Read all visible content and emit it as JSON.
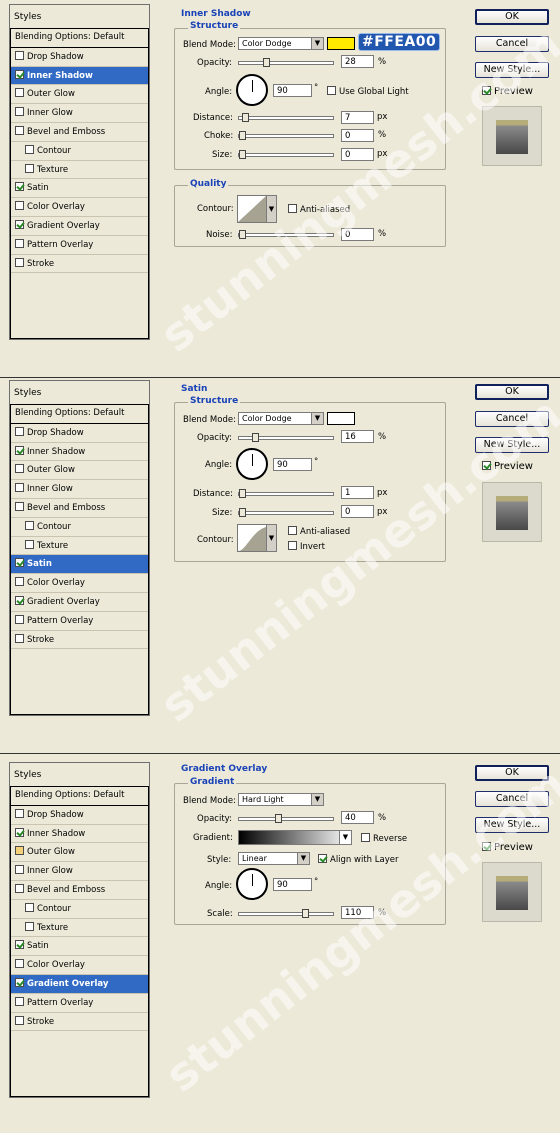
{
  "panels": [
    {
      "styles_title": "Styles",
      "items": [
        {
          "label": "Blending Options: Default",
          "check": false,
          "selected": false
        },
        {
          "label": "Drop Shadow",
          "check": false
        },
        {
          "label": "Inner Shadow",
          "check": true,
          "selected": true
        },
        {
          "label": "Outer Glow",
          "check": false
        },
        {
          "label": "Inner Glow",
          "check": false
        },
        {
          "label": "Bevel and Emboss",
          "check": false
        },
        {
          "label": "Contour",
          "check": false,
          "indent": true
        },
        {
          "label": "Texture",
          "check": false,
          "indent": true
        },
        {
          "label": "Satin",
          "check": true
        },
        {
          "label": "Color Overlay",
          "check": false
        },
        {
          "label": "Gradient Overlay",
          "check": true
        },
        {
          "label": "Pattern Overlay",
          "check": false
        },
        {
          "label": "Stroke",
          "check": false
        }
      ],
      "section_title": "Inner Shadow",
      "structure_title": "Structure",
      "blend_mode_label": "Blend Mode:",
      "blend_mode": "Color Dodge",
      "swatch_color": "#FFEA00",
      "opacity_label": "Opacity:",
      "opacity": "28",
      "angle_label": "Angle:",
      "angle": "90",
      "global_light_label": "Use Global Light",
      "distance_label": "Distance:",
      "distance": "7",
      "choke_label": "Choke:",
      "choke": "0",
      "size_label": "Size:",
      "size": "0",
      "quality_title": "Quality",
      "contour_label": "Contour:",
      "anti_aliased_label": "Anti-aliased",
      "noise_label": "Noise:",
      "noise": "0",
      "annotation": "#FFEA00"
    },
    {
      "styles_title": "Styles",
      "section_title": "Satin",
      "structure_title": "Structure",
      "blend_mode_label": "Blend Mode:",
      "blend_mode": "Color Dodge",
      "swatch_color": "#FFFFFF",
      "opacity_label": "Opacity:",
      "opacity": "16",
      "angle_label": "Angle:",
      "angle": "90",
      "distance_label": "Distance:",
      "distance": "1",
      "size_label": "Size:",
      "size": "0",
      "contour_label": "Contour:",
      "anti_aliased_label": "Anti-aliased",
      "invert_label": "Invert",
      "items": [
        {
          "label": "Blending Options: Default",
          "check": false
        },
        {
          "label": "Drop Shadow",
          "check": false
        },
        {
          "label": "Inner Shadow",
          "check": true
        },
        {
          "label": "Outer Glow",
          "check": false
        },
        {
          "label": "Inner Glow",
          "check": false
        },
        {
          "label": "Bevel and Emboss",
          "check": false
        },
        {
          "label": "Contour",
          "check": false,
          "indent": true
        },
        {
          "label": "Texture",
          "check": false,
          "indent": true
        },
        {
          "label": "Satin",
          "check": true,
          "selected": true
        },
        {
          "label": "Color Overlay",
          "check": false
        },
        {
          "label": "Gradient Overlay",
          "check": true
        },
        {
          "label": "Pattern Overlay",
          "check": false
        },
        {
          "label": "Stroke",
          "check": false
        }
      ]
    },
    {
      "styles_title": "Styles",
      "section_title": "Gradient Overlay",
      "structure_title": "Gradient",
      "blend_mode_label": "Blend Mode:",
      "blend_mode": "Hard Light",
      "opacity_label": "Opacity:",
      "opacity": "40",
      "gradient_label": "Gradient:",
      "reverse_label": "Reverse",
      "style_label": "Style:",
      "style": "Linear",
      "align_label": "Align with Layer",
      "angle_label": "Angle:",
      "angle": "90",
      "scale_label": "Scale:",
      "scale": "110",
      "items": [
        {
          "label": "Blending Options: Default",
          "check": false
        },
        {
          "label": "Drop Shadow",
          "check": false
        },
        {
          "label": "Inner Shadow",
          "check": true
        },
        {
          "label": "Outer Glow",
          "check": false,
          "warn": true
        },
        {
          "label": "Inner Glow",
          "check": false
        },
        {
          "label": "Bevel and Emboss",
          "check": false
        },
        {
          "label": "Contour",
          "check": false,
          "indent": true
        },
        {
          "label": "Texture",
          "check": false,
          "indent": true
        },
        {
          "label": "Satin",
          "check": true
        },
        {
          "label": "Color Overlay",
          "check": false
        },
        {
          "label": "Gradient Overlay",
          "check": true,
          "selected": true
        },
        {
          "label": "Pattern Overlay",
          "check": false
        },
        {
          "label": "Stroke",
          "check": false
        }
      ]
    }
  ],
  "buttons": {
    "ok": "OK",
    "cancel": "Cancel",
    "new_style": "New Style...",
    "preview": "Preview"
  },
  "units": {
    "percent": "%",
    "px": "px",
    "degree": "°"
  },
  "watermark": "stunningmesh.com"
}
